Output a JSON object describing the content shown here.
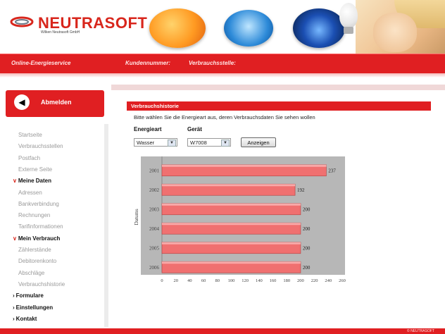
{
  "brand": {
    "name": "NEUTRASOFT",
    "sub": "Wilken Neutrasoft GmbH"
  },
  "topbar": {
    "service": "Online-Energieservice",
    "customer_no": "Kundennummer:",
    "consumption_point": "Verbrauchsstelle:"
  },
  "sidebar": {
    "logout": "Abmelden",
    "items": [
      {
        "label": "Startseite",
        "type": "link"
      },
      {
        "label": "Verbrauchsstellen",
        "type": "link"
      },
      {
        "label": "Postfach",
        "type": "link"
      },
      {
        "label": "Externe Seite",
        "type": "link"
      },
      {
        "label": "Meine Daten",
        "type": "head-open"
      },
      {
        "label": "Adressen",
        "type": "link"
      },
      {
        "label": "Bankverbindung",
        "type": "link"
      },
      {
        "label": "Rechnungen",
        "type": "link"
      },
      {
        "label": "Tarifinformationen",
        "type": "link"
      },
      {
        "label": "Mein Verbrauch",
        "type": "head-open"
      },
      {
        "label": "Zählerstände",
        "type": "link"
      },
      {
        "label": "Debitorenkonto",
        "type": "link"
      },
      {
        "label": "Abschläge",
        "type": "link"
      },
      {
        "label": "Verbrauchshistorie",
        "type": "link"
      },
      {
        "label": "Formulare",
        "type": "head-closed"
      },
      {
        "label": "Einstellungen",
        "type": "head-closed"
      },
      {
        "label": "Kontakt",
        "type": "head-closed"
      }
    ]
  },
  "main": {
    "section_title": "Verbrauchshistorie",
    "instruction": "Bitte wählen Sie die Energieart aus, deren Verbrauchsdaten Sie sehen wollen",
    "energy_label": "Energieart",
    "device_label": "Gerät",
    "energy_value": "Wasser",
    "device_value": "W7008",
    "show_button": "Anzeigen"
  },
  "chart_data": {
    "type": "bar",
    "orientation": "horizontal",
    "categories": [
      "2001",
      "2002",
      "2003",
      "2004",
      "2005",
      "2006"
    ],
    "values": [
      237,
      192,
      200,
      200,
      200,
      200
    ],
    "ylabel": "Datums",
    "xlim": [
      0,
      260
    ],
    "xticks": [
      0,
      20,
      40,
      60,
      80,
      100,
      120,
      140,
      160,
      180,
      200,
      220,
      240,
      260
    ],
    "bar_color": "#f07070",
    "plot_bg": "#b7b7b7"
  },
  "footer": {
    "text": "© NEUTRASOFT"
  },
  "colors": {
    "accent": "#e01f22"
  }
}
